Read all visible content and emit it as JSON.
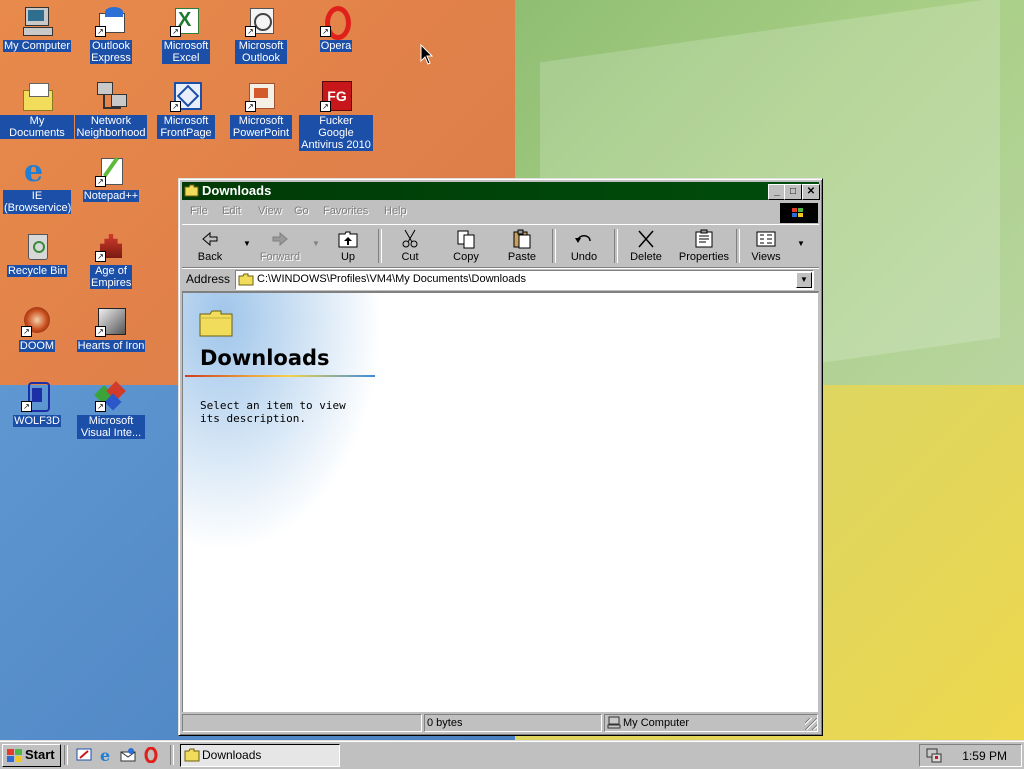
{
  "desktop": {
    "icons": [
      {
        "label": "My Computer"
      },
      {
        "label": "Outlook Express"
      },
      {
        "label": "Microsoft Excel"
      },
      {
        "label": "Microsoft Outlook"
      },
      {
        "label": "Opera"
      },
      {
        "label": "My Documents"
      },
      {
        "label": "Network Neighborhood"
      },
      {
        "label": "Microsoft FrontPage"
      },
      {
        "label": "Microsoft PowerPoint"
      },
      {
        "label": "Fucker Google Antivirus 2010"
      },
      {
        "label": "IE (Browservice)"
      },
      {
        "label": "Notepad++"
      },
      {
        "label": "Recycle Bin"
      },
      {
        "label": "Age of Empires"
      },
      {
        "label": "DOOM"
      },
      {
        "label": "Hearts of Iron"
      },
      {
        "label": "WOLF3D"
      },
      {
        "label": "Microsoft Visual Inte..."
      }
    ]
  },
  "window": {
    "title": "Downloads",
    "menu": [
      "File",
      "Edit",
      "View",
      "Go",
      "Favorites",
      "Help"
    ],
    "toolbar": {
      "back": "Back",
      "forward": "Forward",
      "up": "Up",
      "cut": "Cut",
      "copy": "Copy",
      "paste": "Paste",
      "undo": "Undo",
      "delete": "Delete",
      "properties": "Properties",
      "views": "Views"
    },
    "address_label": "Address",
    "address_value": "C:\\WINDOWS\\Profiles\\VM4\\My Documents\\Downloads",
    "folder_title": "Downloads",
    "description": "Select an item to view its description.",
    "status": {
      "size": "0 bytes",
      "zone": "My Computer"
    }
  },
  "taskbar": {
    "start": "Start",
    "task": "Downloads",
    "clock": "1:59 PM"
  }
}
